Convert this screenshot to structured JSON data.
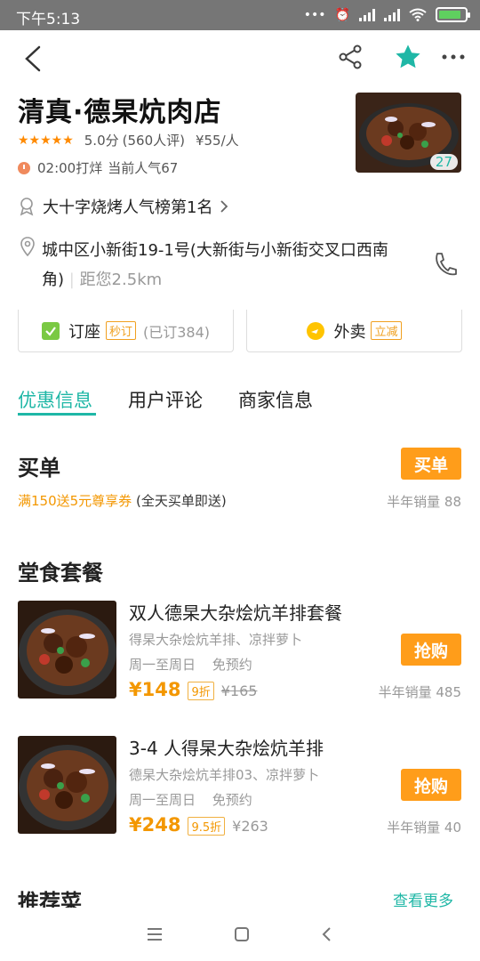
{
  "status_bar": {
    "time": "下午5:13"
  },
  "shop": {
    "name": "清真·德杲炕肉店",
    "rating": "5.0分",
    "reviews": "(560人评)",
    "price_per_person": "¥55/人",
    "hours": "02:00打烊",
    "popularity": "当前人气67",
    "photo_count": "27",
    "rank": "大十字烧烤人气榜第1名",
    "address": "城中区小新街19-1号(大新街与小新街交叉口西南角)",
    "distance": "距您2.5km"
  },
  "actions": {
    "reserve_label": "订座",
    "reserve_tag": "秒订",
    "reserve_count": "(已订384)",
    "takeout_label": "外卖",
    "takeout_tag": "立减"
  },
  "tabs": [
    {
      "label": "优惠信息",
      "active": true
    },
    {
      "label": "用户评论",
      "active": false
    },
    {
      "label": "商家信息",
      "active": false
    }
  ],
  "pay": {
    "title": "买单",
    "button": "买单",
    "promo_highlight": "满150送5元尊享券",
    "promo_rest": "(全天买单即送)",
    "sales": "半年销量 88"
  },
  "dine_in": {
    "title": "堂食套餐",
    "deals": [
      {
        "title": "双人德杲大杂烩炕羊排套餐",
        "items": "得杲大杂烩炕羊排、凉拌萝卜",
        "days": "周一至周日",
        "booking": "免预约",
        "price": "¥148",
        "discount": "9折",
        "original_price": "¥165",
        "sales": "半年销量 485",
        "button": "抢购"
      },
      {
        "title": "3-4 人得杲大杂烩炕羊排",
        "items": "德杲大杂烩炕羊排03、凉拌萝卜",
        "days": "周一至周日",
        "booking": "免预约",
        "price": "¥248",
        "discount": "9.5折",
        "original_price": "¥263",
        "sales": "半年销量 40",
        "button": "抢购"
      }
    ]
  },
  "recommend": {
    "title": "推荐菜",
    "more": "查看更多"
  },
  "colors": {
    "accent": "#1fb7a6",
    "orange": "#ff9d1a",
    "price": "#f39700"
  }
}
